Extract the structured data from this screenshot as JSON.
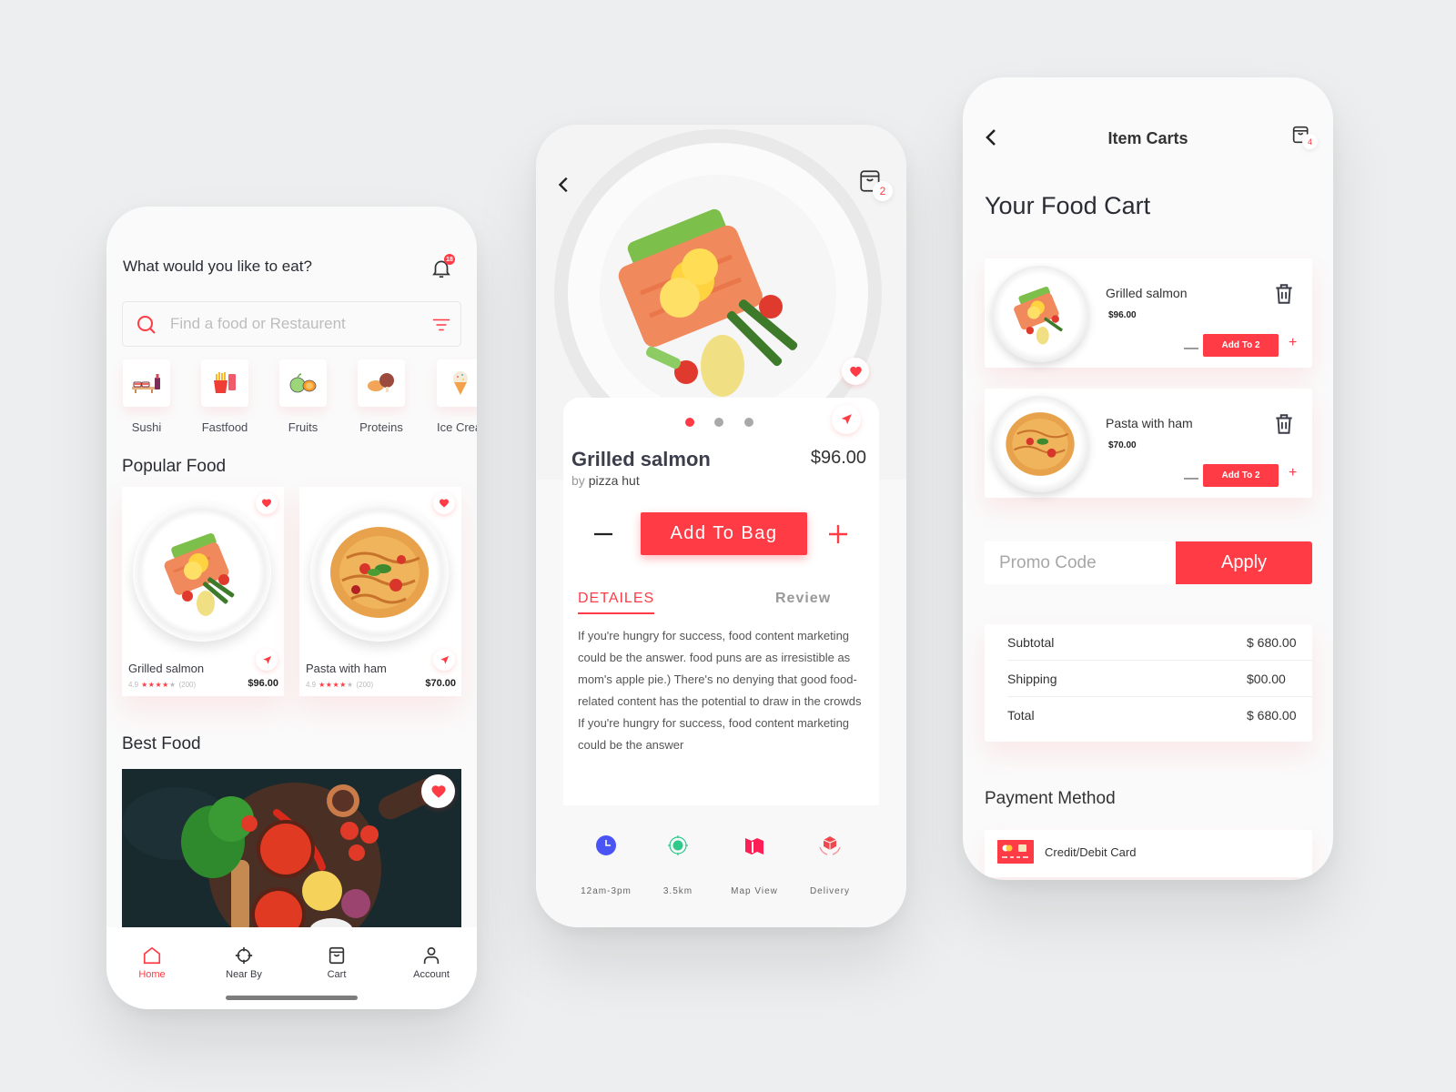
{
  "colors": {
    "accent": "#ff3b45",
    "background": "#eceeef",
    "phone_bg": "#fafafa",
    "info_clock": "#4a54f5",
    "info_distance": "#2fc98a",
    "info_map": "#ff1f57",
    "info_delivery": "#f0484f"
  },
  "home": {
    "greeting": "What would  you like to eat?",
    "notification_count": "18",
    "search": {
      "placeholder": "Find a food or Restaurent",
      "value": ""
    },
    "categories": [
      {
        "label": "Sushi",
        "icon": "sushi-icon"
      },
      {
        "label": "Fastfood",
        "icon": "fries-icon"
      },
      {
        "label": "Fruits",
        "icon": "fruit-icon"
      },
      {
        "label": "Proteins",
        "icon": "drumstick-icon"
      },
      {
        "label": "Ice Cream",
        "icon": "ice-cream-icon"
      }
    ],
    "popular_title": "Popular Food",
    "popular": [
      {
        "name": "Grilled salmon",
        "rating": "4.9",
        "stars": "★★★★",
        "star_empty": "★",
        "reviews": "(200)",
        "price": "$96.00"
      },
      {
        "name": "Pasta with ham",
        "rating": "4.9",
        "stars": "★★★★",
        "star_empty": "★",
        "reviews": "(200)",
        "price": "$70.00"
      }
    ],
    "best_title": "Best  Food",
    "tabs": [
      {
        "label": "Home",
        "active": true
      },
      {
        "label": "Near By",
        "active": false
      },
      {
        "label": "Cart",
        "active": false
      },
      {
        "label": "Account",
        "active": false
      }
    ]
  },
  "detail": {
    "cart_count": "2",
    "title": "Grilled salmon",
    "by_prefix": "by",
    "restaurant": "pizza hut",
    "price": "$96.00",
    "add_button": "Add To Bag",
    "carousel": {
      "count": 3,
      "active": 1
    },
    "tabs": {
      "details": "DETAILES",
      "review": "Review"
    },
    "description": "If you're hungry for success, food content marketing could be the answer. food puns are as irresistible as mom's apple pie.) There's no denying that good food-related content has the potential to draw in the crowds If you're hungry for success, food content marketing could be the answer",
    "info": [
      {
        "label": "12am-3pm",
        "icon": "clock-icon"
      },
      {
        "label": "3.5km",
        "icon": "location-target-icon"
      },
      {
        "label": "Map View",
        "icon": "map-icon"
      },
      {
        "label": "Delivery",
        "icon": "delivery-box-icon"
      }
    ]
  },
  "cart": {
    "header_title": "Item Carts",
    "cart_count": "4",
    "heading": "Your Food Cart",
    "items": [
      {
        "name": "Grilled salmon",
        "price": "$96.00",
        "button": "Add To 2"
      },
      {
        "name": "Pasta with ham",
        "price": "$70.00",
        "button": "Add To 2"
      }
    ],
    "promo": {
      "placeholder": "Promo Code",
      "value": "",
      "button": "Apply"
    },
    "summary": [
      {
        "label": "Subtotal",
        "value": "$ 680.00"
      },
      {
        "label": "Shipping",
        "value": "$00.00"
      },
      {
        "label": "Total",
        "value": "$ 680.00"
      }
    ],
    "payment_title": "Payment Method",
    "payment_option": "Credit/Debit Card"
  }
}
